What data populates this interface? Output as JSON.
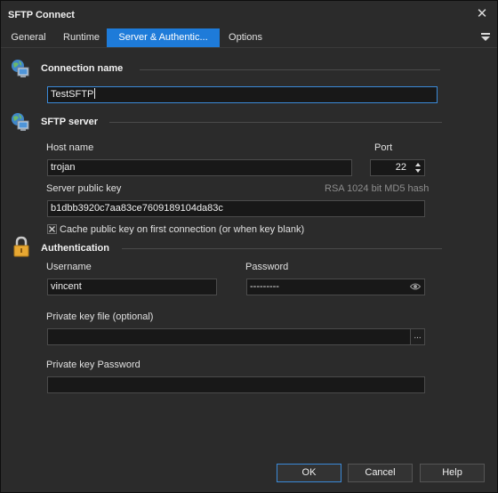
{
  "window": {
    "title": "SFTP Connect",
    "close_icon": "close-icon"
  },
  "tabs": [
    {
      "label": "General",
      "active": false
    },
    {
      "label": "Runtime",
      "active": false
    },
    {
      "label": "Server & Authentic...",
      "active": true
    },
    {
      "label": "Options",
      "active": false
    }
  ],
  "sections": {
    "connection": {
      "title": "Connection name",
      "icon": "network-computer-icon",
      "name_value": "TestSFTP"
    },
    "server": {
      "title": "SFTP server",
      "icon": "network-computer-icon",
      "host_label": "Host name",
      "host_value": "trojan",
      "port_label": "Port",
      "port_value": "22",
      "pubkey_label": "Server public key",
      "pubkey_hint": "RSA 1024 bit MD5 hash",
      "pubkey_value": "b1dbb3920c7aa83ce7609189104da83c",
      "cache_label": "Cache public key on first connection (or when key blank)",
      "cache_checked": true
    },
    "auth": {
      "title": "Authentication",
      "icon": "padlock-icon",
      "username_label": "Username",
      "username_value": "vincent",
      "password_label": "Password",
      "password_value": "---------",
      "keyfile_label": "Private key file (optional)",
      "keyfile_value": "",
      "browse_label": "...",
      "keypass_label": "Private key Password",
      "keypass_value": ""
    }
  },
  "buttons": {
    "ok": "OK",
    "cancel": "Cancel",
    "help": "Help"
  },
  "colors": {
    "accent": "#1e7bd9",
    "background": "#2b2b2b",
    "input_bg": "#181818",
    "focus_border": "#3b8ad8"
  }
}
